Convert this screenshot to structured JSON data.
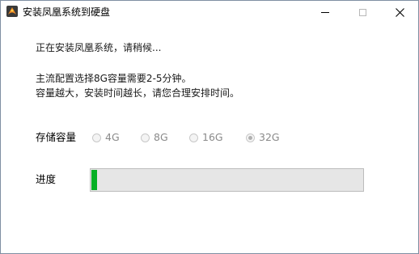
{
  "window": {
    "title": "安装凤凰系统到硬盘",
    "controls": [
      "minimize",
      "maximize",
      "close"
    ]
  },
  "status_text": "正在安装凤凰系统，请稍候...",
  "info": {
    "line1": "主流配置选择8G容量需要2-5分钟。",
    "line2": "容量越大，安装时间越长，请您合理安排时间。"
  },
  "storage": {
    "label": "存储容量",
    "options": [
      {
        "label": "4G",
        "checked": false,
        "enabled": false
      },
      {
        "label": "8G",
        "checked": false,
        "enabled": false
      },
      {
        "label": "16G",
        "checked": false,
        "enabled": false
      },
      {
        "label": "32G",
        "checked": true,
        "enabled": false
      }
    ]
  },
  "progress": {
    "label": "进度",
    "fraction": 0.02,
    "fill_color": "#06b025"
  },
  "icons": {
    "app": "phoenix-os-icon",
    "minimize": "minimize-icon",
    "maximize": "maximize-icon",
    "close": "close-icon"
  }
}
